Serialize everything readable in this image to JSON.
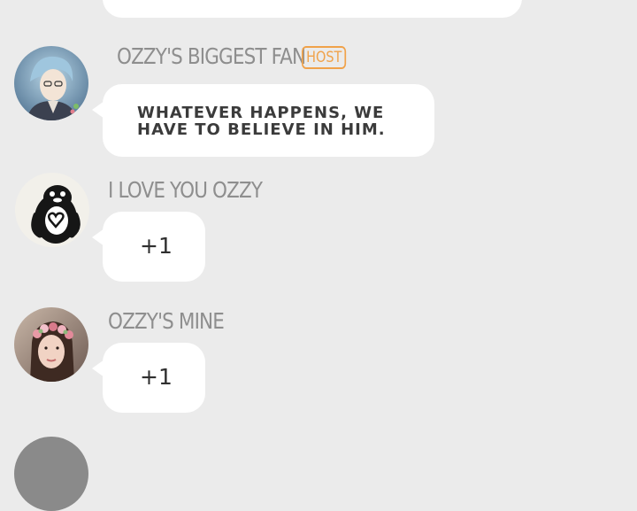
{
  "messages": [
    {
      "username": "OZZY'S BIGGEST FAN",
      "badge": "HOST",
      "text_line1": "WHATEVER HAPPENS, WE",
      "text_line2": "HAVE TO BELIEVE IN HIM.",
      "avatar_icon": "anime-character-avatar-icon"
    },
    {
      "username": "I LOVE YOU OZZY",
      "text": "+1",
      "avatar_icon": "penguin-heart-avatar-icon"
    },
    {
      "username": "OZZY'S MINE",
      "text": "+1",
      "avatar_icon": "flower-crown-avatar-icon"
    }
  ],
  "colors": {
    "background": "#ebebeb",
    "bubble": "#ffffff",
    "username": "#8e8e8e",
    "host_badge": "#f0a24a",
    "message_text": "#3b3b3b"
  }
}
